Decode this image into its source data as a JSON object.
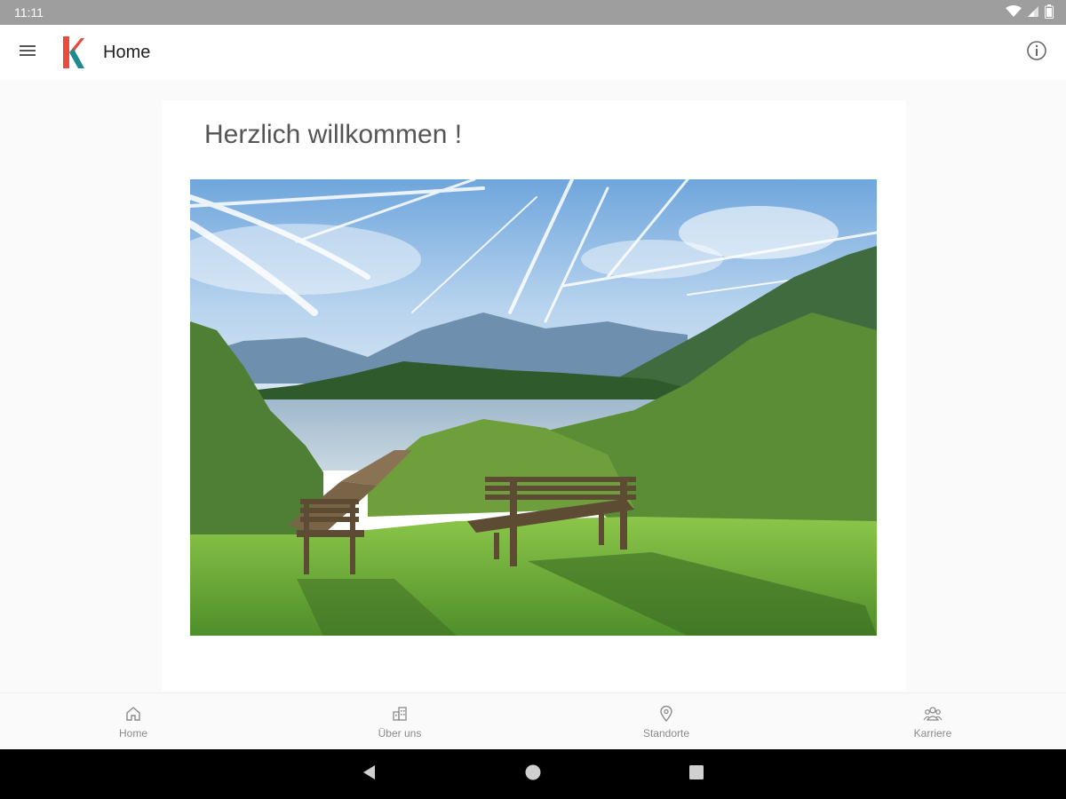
{
  "status_bar": {
    "time": "11:11",
    "icons": [
      "wifi-icon",
      "signal-icon",
      "battery-icon"
    ]
  },
  "app_bar": {
    "title": "Home",
    "menu_icon": "menu-icon",
    "logo": "brand-logo",
    "info_icon": "info-icon"
  },
  "main": {
    "heading": "Herzlich willkommen !",
    "image": "landscape-photo"
  },
  "bottom_nav": {
    "items": [
      {
        "label": "Home",
        "icon": "home-icon"
      },
      {
        "label": "Über uns",
        "icon": "building-icon"
      },
      {
        "label": "Standorte",
        "icon": "location-pin-icon"
      },
      {
        "label": "Karriere",
        "icon": "people-icon"
      }
    ]
  },
  "colors": {
    "logo_red": "#e94b3c",
    "logo_teal": "#1f8a8f",
    "status_bar": "#9e9e9e",
    "nav_inactive": "#8a8a8a"
  }
}
